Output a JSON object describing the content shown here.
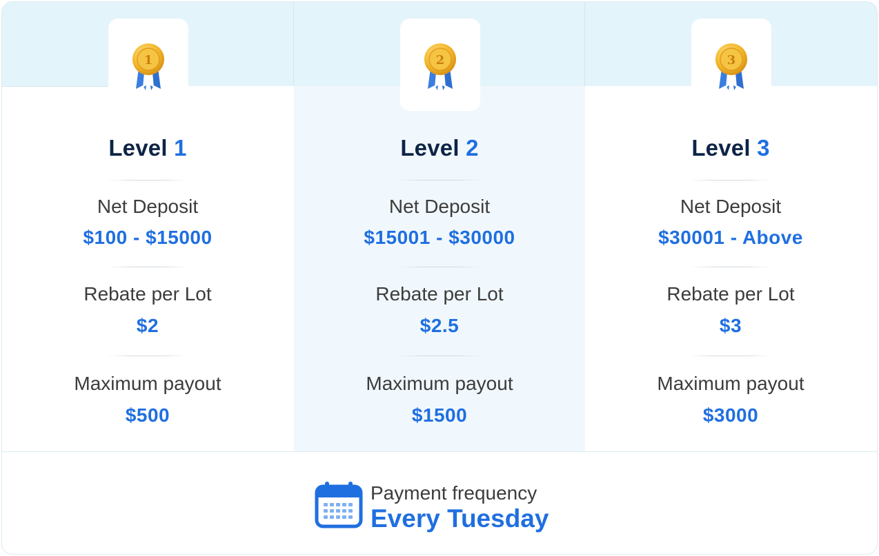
{
  "levels": [
    {
      "medal_icon": "gold-medal-1-icon",
      "medal_number": "1",
      "title_word": "Level",
      "title_number": "1",
      "deposit_label": "Net Deposit",
      "deposit_value": "$100 - $15000",
      "rebate_label": "Rebate per Lot",
      "rebate_value": "$2",
      "payout_label": "Maximum payout",
      "payout_value": "$500"
    },
    {
      "medal_icon": "gold-medal-2-icon",
      "medal_number": "2",
      "title_word": "Level",
      "title_number": "2",
      "deposit_label": "Net Deposit",
      "deposit_value": "$15001 - $30000",
      "rebate_label": "Rebate per Lot",
      "rebate_value": "$2.5",
      "payout_label": "Maximum payout",
      "payout_value": "$1500"
    },
    {
      "medal_icon": "gold-medal-3-icon",
      "medal_number": "3",
      "title_word": "Level",
      "title_number": "3",
      "deposit_label": "Net Deposit",
      "deposit_value": "$30001 - Above",
      "rebate_label": "Rebate per Lot",
      "rebate_value": "$3",
      "payout_label": "Maximum payout",
      "payout_value": "$3000"
    }
  ],
  "footer": {
    "icon": "calendar-icon",
    "label": "Payment frequency",
    "value": "Every Tuesday"
  },
  "colors": {
    "accent": "#1f6fe0",
    "title": "#0d2446",
    "text": "#3c3c3c",
    "header_band": "#e4f4fb",
    "highlight_column": "#f1f8fd",
    "medal_gold": "#f2b830",
    "ribbon_blue": "#3a7fe0"
  }
}
